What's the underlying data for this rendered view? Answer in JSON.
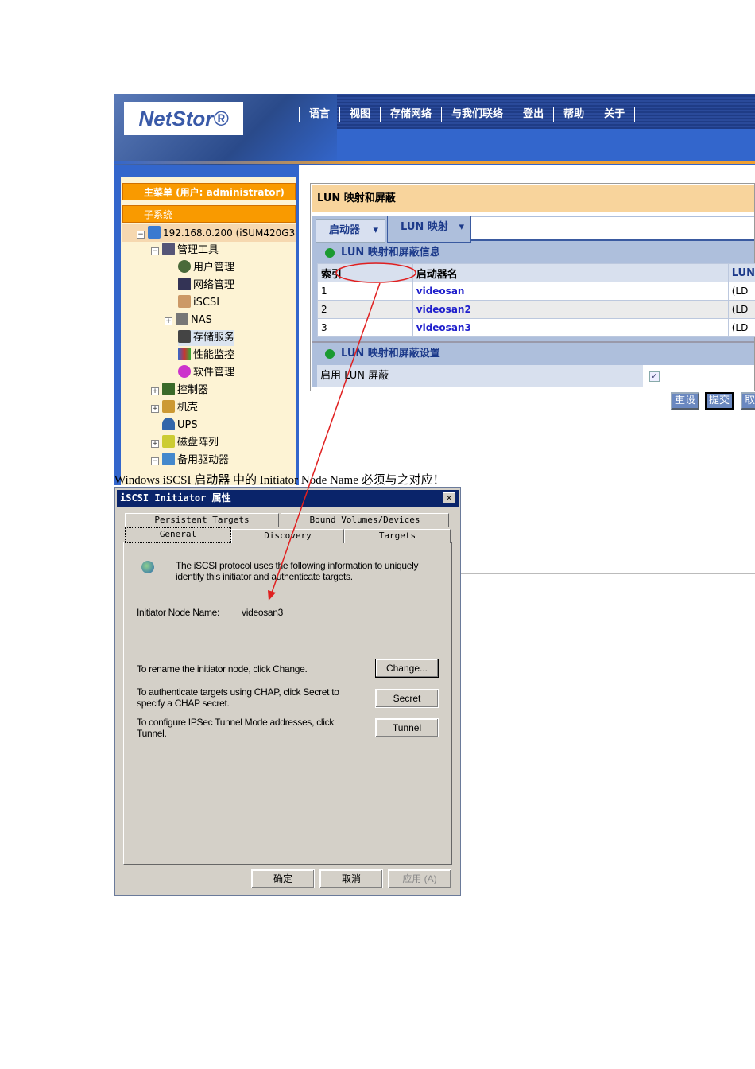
{
  "header": {
    "logo": "NetStor®",
    "nav": [
      "语言",
      "视图",
      "存储网络",
      "与我们联络",
      "登出",
      "帮助",
      "关于"
    ]
  },
  "sidebar": {
    "main_menu": "主菜单 (用户: administrator)",
    "subsystem": "子系统",
    "tree": [
      "192.168.0.200 (iSUM420G3",
      "管理工具",
      "用户管理",
      "网络管理",
      "iSCSI",
      "NAS",
      "存储服务",
      "性能监控",
      "软件管理",
      "控制器",
      "机壳",
      "UPS",
      "磁盘阵列",
      "备用驱动器"
    ]
  },
  "panel": {
    "title": "LUN 映射和屏蔽",
    "tabs": [
      "启动器",
      "LUN 映射"
    ],
    "info_section": "LUN 映射和屏蔽信息",
    "columns": [
      "索引",
      "启动器名",
      "LUN"
    ],
    "rows": [
      {
        "index": "1",
        "name": "videosan",
        "lun": "(LD"
      },
      {
        "index": "2",
        "name": "videosan2",
        "lun": "(LD"
      },
      {
        "index": "3",
        "name": "videosan3",
        "lun": "(LD"
      }
    ],
    "settings_section": "LUN 映射和屏蔽设置",
    "enable_label": "启用  LUN 屏蔽",
    "enable_checked": true,
    "buttons": [
      "重设",
      "提交",
      "取"
    ]
  },
  "caption": "Windows iSCSI 启动器 中的 Initiator Node Name 必须与之对应！",
  "dialog": {
    "title": "iSCSI Initiator 属性",
    "close": "✕",
    "tabs_row1": [
      "Persistent Targets",
      "Bound Volumes/Devices"
    ],
    "tabs_row2": [
      "General",
      "Discovery",
      "Targets"
    ],
    "intro": "The iSCSI protocol uses the following information to uniquely identify this initiator and authenticate targets.",
    "node_label": "Initiator Node Name:",
    "node_value": "videosan3",
    "rename_text": "To rename the initiator node, click Change.",
    "change_btn": "Change...",
    "chap_text": "To authenticate targets using CHAP, click Secret to specify a CHAP secret.",
    "secret_btn": "Secret",
    "tunnel_text": "To configure IPSec Tunnel Mode addresses, click Tunnel.",
    "tunnel_btn": "Tunnel",
    "ok": "确定",
    "cancel": "取消",
    "apply": "应用 (A)"
  },
  "colors": {
    "header_blue": "#3366cc",
    "orange": "#f99a00",
    "annotation": "#e02020"
  }
}
